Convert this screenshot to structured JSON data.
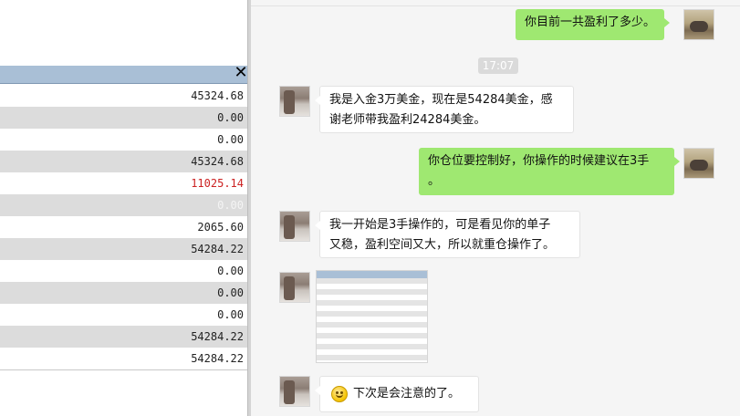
{
  "left_panel": {
    "close_symbol": "✕",
    "rows": [
      {
        "value": "45324.68",
        "style": "normal"
      },
      {
        "value": "0.00",
        "style": "normal"
      },
      {
        "value": "0.00",
        "style": "normal"
      },
      {
        "value": "45324.68",
        "style": "normal"
      },
      {
        "value": "11025.14",
        "style": "red"
      },
      {
        "value": "0.00",
        "style": "faded"
      },
      {
        "value": "2065.60",
        "style": "normal"
      },
      {
        "value": "54284.22",
        "style": "normal"
      },
      {
        "value": "0.00",
        "style": "normal"
      },
      {
        "value": "0.00",
        "style": "normal"
      },
      {
        "value": "0.00",
        "style": "normal"
      },
      {
        "value": "54284.22",
        "style": "normal"
      },
      {
        "value": "54284.22",
        "style": "normal"
      }
    ]
  },
  "chat": {
    "messages": [
      {
        "sender": "self",
        "text": "你目前一共盈利了多少。"
      },
      {
        "type": "time",
        "text": "17:07"
      },
      {
        "sender": "other",
        "lines": [
          "我是入金3万美金，现在是54284美金，感",
          "谢老师带我盈利24284美金。"
        ]
      },
      {
        "sender": "self",
        "lines": [
          "你仓位要控制好，你操作的时候建议在3手",
          "。"
        ]
      },
      {
        "sender": "other",
        "lines": [
          "我一开始是3手操作的，可是看见你的单子",
          "又稳，盈利空间又大，所以就重仓操作了。"
        ]
      },
      {
        "sender": "other",
        "type": "image",
        "description": "account-screenshot-thumbnail"
      },
      {
        "sender": "other",
        "emoji": "smile-emoji",
        "text": "下次是会注意的了。"
      }
    ]
  },
  "colors": {
    "green_bubble": "#9fe871",
    "white_bubble": "#ffffff",
    "red_value": "#cc2222",
    "panel_header": "#a9bfd6"
  }
}
